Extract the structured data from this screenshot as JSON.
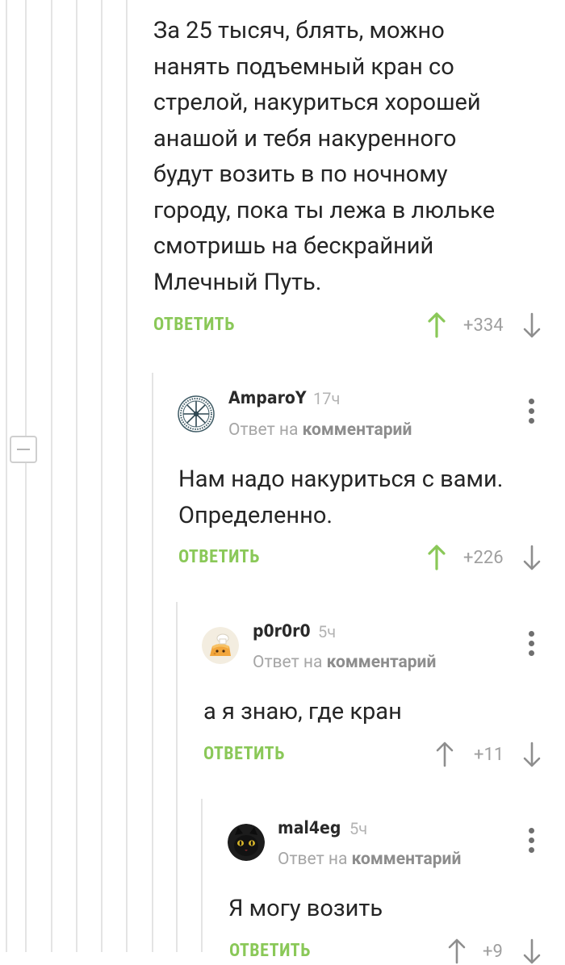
{
  "comments": [
    {
      "body_lines": [
        "За 25 тысяч, блять, можно",
        "нанять подъемный кран со",
        "стрелой, накуриться хорошей",
        "анашой и тебя накуренного",
        "будут возить в по ночному",
        "городу, пока ты лежа в люльке",
        "смотришь на бескрайний",
        "Млечный Путь."
      ],
      "reply_label": "ОТВЕТИТЬ",
      "score": "+334"
    },
    {
      "author": "AmparoY",
      "time": "17ч",
      "reply_to_prefix": "Ответ на",
      "reply_to_target": "комментарий",
      "body_lines": [
        "Нам надо накуриться с вами.",
        "Определенно."
      ],
      "reply_label": "ОТВЕТИТЬ",
      "score": "+226"
    },
    {
      "author": "p0r0r0",
      "time": "5ч",
      "reply_to_prefix": "Ответ на",
      "reply_to_target": "комментарий",
      "body_lines": [
        "а я знаю, где кран"
      ],
      "reply_label": "ОТВЕТИТЬ",
      "score": "+11"
    },
    {
      "author": "mal4eg",
      "time": "5ч",
      "reply_to_prefix": "Ответ на",
      "reply_to_target": "комментарий",
      "body_lines": [
        "Я могу возить"
      ],
      "reply_label": "ОТВЕТИТЬ",
      "score": "+9"
    }
  ],
  "icons": {
    "upvote": "arrow-up-icon",
    "downvote": "arrow-down-icon",
    "more": "more-vertical-icon",
    "collapse": "minus-icon"
  },
  "colors": {
    "accent_green": "#8ac858",
    "upvote_active": "#8ac858",
    "downvote": "#8e8e8e",
    "text": "#252525",
    "muted": "#a6a6a6",
    "thread_line": "#e4e4e4"
  }
}
